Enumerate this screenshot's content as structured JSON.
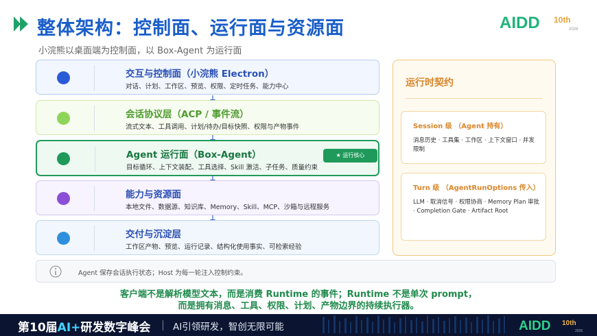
{
  "header": {
    "title": "整体架构：控制面、运行面与资源面",
    "subtitle": "小浣熊以桌面端为控制面，以 Box-Agent 为运行面",
    "logo_text": "AIDD",
    "logo_edition": "10th",
    "logo_year": "2026"
  },
  "layers": [
    {
      "title": "交互与控制面（小浣熊 Electron）",
      "desc": "对话、计划、工作区、预览、权限、定时任务、能力中心",
      "color": "#2a5bd7"
    },
    {
      "title": "会话协议层（ACP / 事件流）",
      "desc": "流式文本、工具调用、计划/待办/目标快照、权限与产物事件",
      "color": "#8fd45a"
    },
    {
      "title": "Agent 运行面（Box-Agent）",
      "desc": "目标循环、上下文装配、工具选择、Skill 激活、子任务、质量约束",
      "color": "#1f9a5a",
      "badge": "★ 运行核心"
    },
    {
      "title": "能力与资源面",
      "desc": "本地文件、数据源、知识库、Memory、Skill、MCP、沙箱与远程服务",
      "color": "#8a4fd6"
    },
    {
      "title": "交付与沉淀层",
      "desc": "工作区产物、预览、运行记录、结构化使用事实、可检索经验",
      "color": "#2f8fdd"
    }
  ],
  "contract": {
    "title": "运行时契约",
    "session": {
      "title": "Session 级 （Agent 持有）",
      "body": "消息历史 · 工具集 · 工作区 · 上下文窗口 · 并发限制"
    },
    "turn": {
      "title": "Turn 级 （AgentRunOptions 传入）",
      "body": "LLM · 取消信号 · 权限协商 · Memory Plan 审批 · Completion Gate · Artifact Root"
    }
  },
  "note": "Agent 保存会话执行状态；Host 为每一轮注入控制约束。",
  "conclusion": {
    "line1": "客户端不是解析模型文本，而是消费 Runtime 的事件；Runtime 不是单次 prompt，",
    "line2": "而是拥有消息、工具、权限、计划、产物边界的持续执行器。"
  },
  "footer": {
    "title_prefix": "第10届",
    "title_ai": "AI+",
    "title_suffix": "研发数字峰会",
    "slogan": "AI引领研发，智创无限可能",
    "logo_text": "AIDD",
    "logo_edition": "10th",
    "logo_year": "2026"
  },
  "colors": {
    "title_blue": "#1a5ec9",
    "accent_orange": "#d9862b",
    "conclusion_green": "#1f8a4c",
    "footer_bg": "#0b1430"
  }
}
